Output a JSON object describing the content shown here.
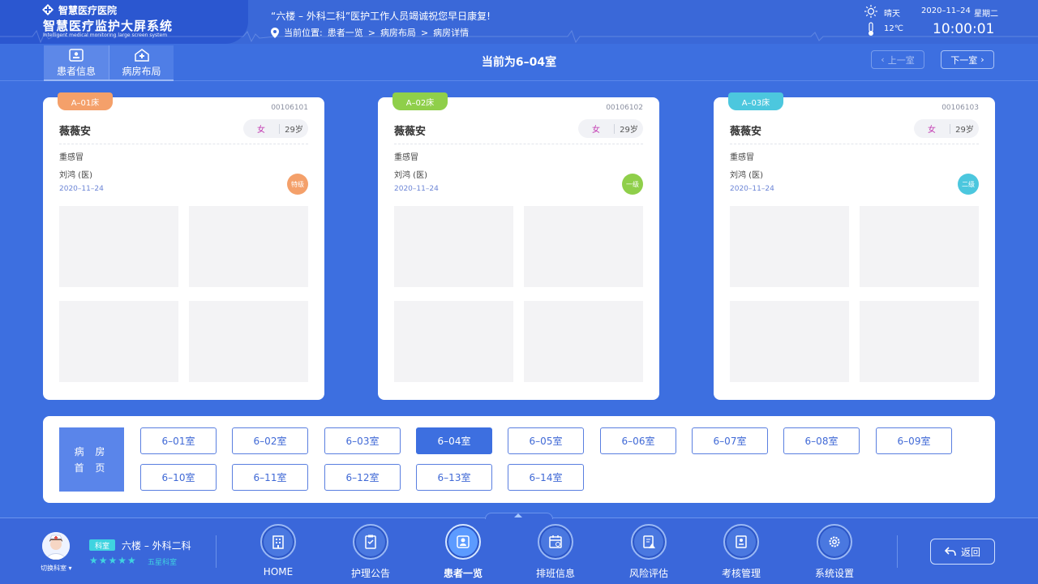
{
  "header": {
    "hospital_name": "智慧医疗医院",
    "system_title": "智慧医疗监护大屏系统",
    "system_subtitle": "Intelligent medical monitoring large screen system",
    "banner": "“六楼 – 外科二科”医护工作人员竭诚祝您早日康复!",
    "location_label": "当前位置:",
    "breadcrumb": [
      "患者一览",
      "病房布局",
      "病房详情"
    ],
    "weather": "晴天",
    "temperature": "12℃",
    "date": "2020–11–24",
    "weekday": "星期二",
    "time": "10:00:01"
  },
  "tabs": [
    {
      "label": "患者信息",
      "icon": "patient-card-icon"
    },
    {
      "label": "病房布局",
      "icon": "ward-house-icon"
    }
  ],
  "room_title": "当前为6–04室",
  "nav_buttons": {
    "prev": "上一室",
    "next": "下一室"
  },
  "beds": [
    {
      "bed": "A–01床",
      "tag_color": "#f4a06a",
      "id": "00106101",
      "name": "薇薇安",
      "gender": "女",
      "age": "29岁",
      "diagnosis": "重感冒",
      "doctor": "刘鸿 (医)",
      "date": "2020–11–24",
      "level": "特级",
      "level_color": "#f4a06a"
    },
    {
      "bed": "A–02床",
      "tag_color": "#8fcf4a",
      "id": "00106102",
      "name": "薇薇安",
      "gender": "女",
      "age": "29岁",
      "diagnosis": "重感冒",
      "doctor": "刘鸿 (医)",
      "date": "2020–11–24",
      "level": "一级",
      "level_color": "#8fcf4a"
    },
    {
      "bed": "A–03床",
      "tag_color": "#4cc7de",
      "id": "00106103",
      "name": "薇薇安",
      "gender": "女",
      "age": "29岁",
      "diagnosis": "重感冒",
      "doctor": "刘鸿 (医)",
      "date": "2020–11–24",
      "level": "二级",
      "level_color": "#4cc7de"
    }
  ],
  "room_panel": {
    "home_label_1": "病 房",
    "home_label_2": "首 页",
    "rooms": [
      "6–01室",
      "6–02室",
      "6–03室",
      "6–04室",
      "6–05室",
      "6–06室",
      "6–07室",
      "6–08室",
      "6–09室",
      "6–10室",
      "6–11室",
      "6–12室",
      "6–13室",
      "6–14室"
    ],
    "active_room": "6–04室"
  },
  "footer": {
    "switch_label": "切换科室",
    "dept_badge": "科室",
    "dept_name": "六楼 – 外科二科",
    "stars": "★★★★★",
    "star_label": "五星科室",
    "nav": [
      {
        "label": "HOME",
        "icon": "building-icon"
      },
      {
        "label": "护理公告",
        "icon": "clipboard-icon"
      },
      {
        "label": "患者一览",
        "icon": "patient-list-icon"
      },
      {
        "label": "排班信息",
        "icon": "calendar-icon"
      },
      {
        "label": "风险评估",
        "icon": "risk-document-icon"
      },
      {
        "label": "考核管理",
        "icon": "assessment-icon"
      },
      {
        "label": "系统设置",
        "icon": "gear-icon"
      }
    ],
    "active_nav": "患者一览",
    "back_label": "返回"
  }
}
